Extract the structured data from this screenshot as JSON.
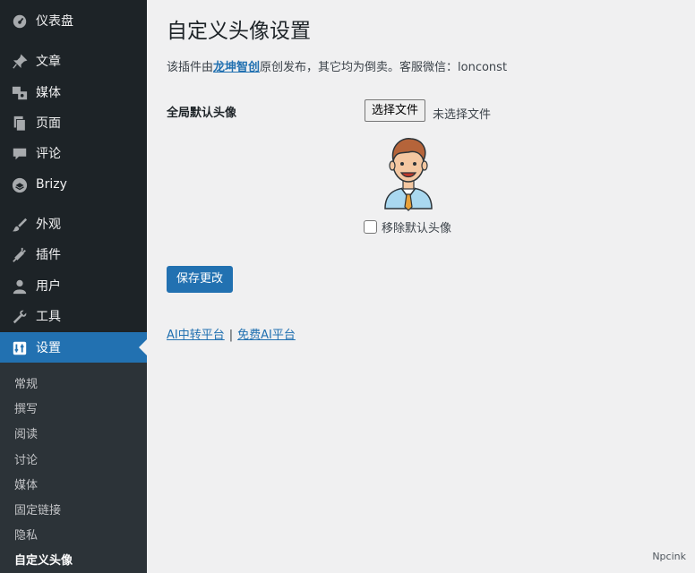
{
  "menu": {
    "items": [
      {
        "label": "仪表盘",
        "icon": "dashboard-icon"
      },
      {
        "label": "文章",
        "icon": "pushpin-icon"
      },
      {
        "label": "媒体",
        "icon": "media-icon"
      },
      {
        "label": "页面",
        "icon": "page-icon"
      },
      {
        "label": "评论",
        "icon": "comment-icon"
      },
      {
        "label": "Brizy",
        "icon": "brizy-icon"
      },
      {
        "label": "外观",
        "icon": "brush-icon"
      },
      {
        "label": "插件",
        "icon": "plugin-icon"
      },
      {
        "label": "用户",
        "icon": "user-icon"
      },
      {
        "label": "工具",
        "icon": "wrench-icon"
      },
      {
        "label": "设置",
        "icon": "settings-icon"
      }
    ],
    "current": "设置",
    "submenu": [
      "常规",
      "撰写",
      "阅读",
      "讨论",
      "媒体",
      "固定链接",
      "隐私",
      "自定义头像"
    ],
    "submenu_current": "自定义头像"
  },
  "page": {
    "title": "自定义头像设置",
    "intro_prefix": "该插件由",
    "intro_link": "龙坤智创",
    "intro_suffix": "原创发布，其它均为倒卖。客服微信：lonconst",
    "field_label": "全局默认头像",
    "file_button": "选择文件",
    "file_status": "未选择文件",
    "avatar_icon": "avatar-icon",
    "remove_label": "移除默认头像",
    "remove_checked": false,
    "save_button": "保存更改",
    "links": [
      "AI中转平台",
      "免费AI平台"
    ],
    "link_separator": "|"
  },
  "footer": {
    "brand": "Npcink"
  },
  "colors": {
    "accent": "#2271b1",
    "menu_bg": "#1d2327",
    "submenu_bg": "#2c3338",
    "page_bg": "#f0f0f1"
  }
}
